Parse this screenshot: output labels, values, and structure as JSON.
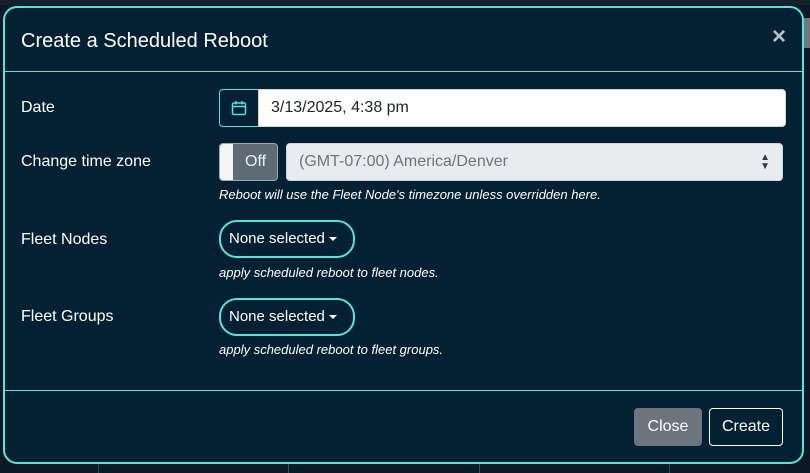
{
  "modal": {
    "title": "Create a Scheduled Reboot",
    "close_symbol": "×"
  },
  "form": {
    "date": {
      "label": "Date",
      "value": "3/13/2025, 4:38 pm",
      "icon": "calendar-icon"
    },
    "timezone": {
      "label": "Change time zone",
      "toggle_state": "Off",
      "selected": "(GMT-07:00) America/Denver",
      "help": "Reboot will use the Fleet Node's timezone unless overridden here."
    },
    "fleet_nodes": {
      "label": "Fleet Nodes",
      "button": "None selected",
      "help": "apply scheduled reboot to fleet nodes."
    },
    "fleet_groups": {
      "label": "Fleet Groups",
      "button": "None selected",
      "help": "apply scheduled reboot to fleet groups."
    }
  },
  "footer": {
    "close_label": "Close",
    "create_label": "Create"
  },
  "colors": {
    "accent": "#58e3d9",
    "modal_bg": "#032133",
    "secondary": "#6c757d"
  }
}
